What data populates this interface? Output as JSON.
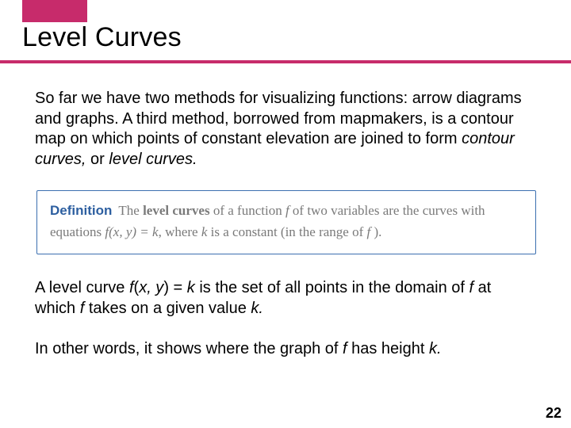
{
  "colors": {
    "accent": "#c72b6b",
    "def_border": "#3b6fb0",
    "def_text": "#7a7a7a",
    "def_label": "#2d5fa0"
  },
  "title": "Level Curves",
  "para1": {
    "pre": "So far we have two methods for visualizing functions: arrow diagrams and graphs. A third method, borrowed from mapmakers, is a contour map on which points of constant elevation are joined to form ",
    "it1": "contour curves,",
    "mid": " or ",
    "it2": "level curves.",
    "post": ""
  },
  "definition": {
    "label": "Definition",
    "t1": "The ",
    "bold": "level curves",
    "t2": " of a function ",
    "f1": "f",
    "t3": " of two variables are the curves with equations ",
    "eq": "f(x, y) = k",
    "t4": ", where ",
    "k": "k",
    "t5": " is a constant (in the range of ",
    "f2": "f",
    "t6": " )."
  },
  "para2": {
    "t1": "A level curve ",
    "eq": "f",
    "t1b": "(",
    "x": "x, y",
    "t1c": ") = ",
    "k": "k",
    "t2": " is the set of all points in the domain of ",
    "f2": "f",
    "t3": " at which ",
    "f3": "f",
    "t4": " takes on a given value ",
    "k2": "k.",
    "t5": ""
  },
  "para3": {
    "t1": "In other words, it shows where the graph of ",
    "f": "f",
    "t2": " has height ",
    "k": "k.",
    "t3": ""
  },
  "page_number": "22"
}
